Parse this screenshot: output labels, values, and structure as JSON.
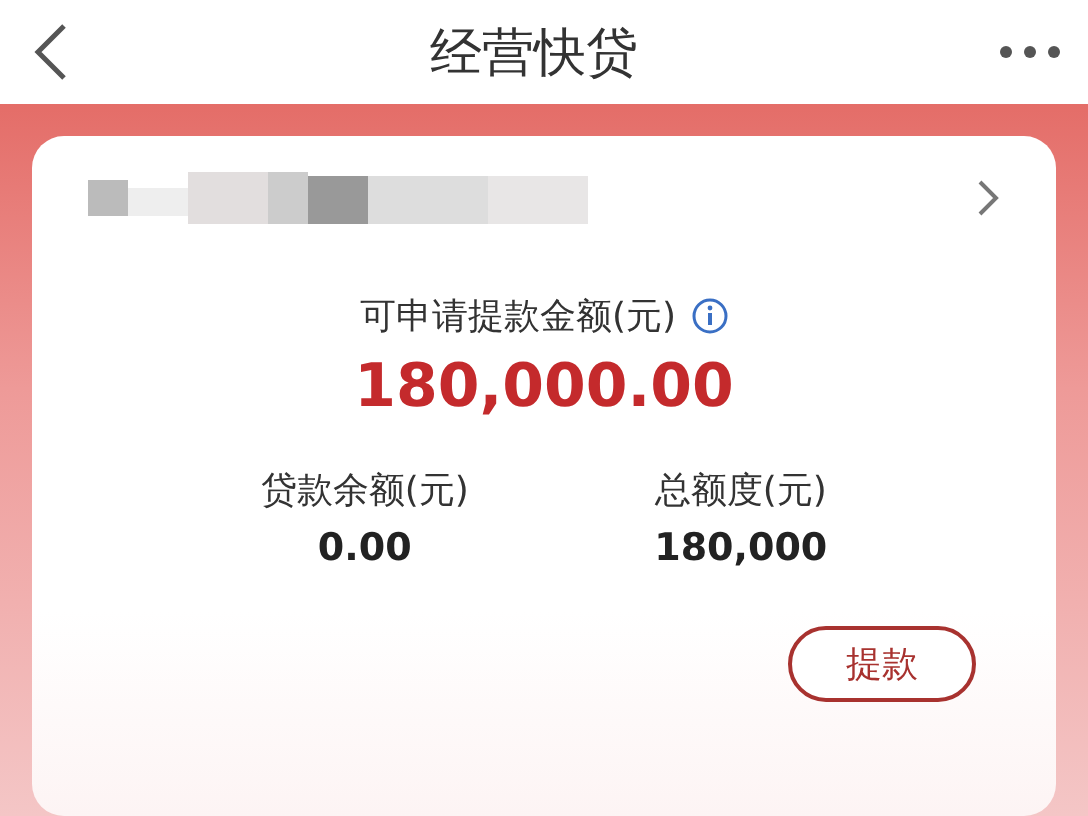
{
  "header": {
    "title": "经营快贷"
  },
  "card": {
    "available_label": "可申请提款金额(元)",
    "available_amount": "180,000.00",
    "stats": [
      {
        "label": "贷款余额(元)",
        "value": "0.00"
      },
      {
        "label": "总额度(元)",
        "value": "180,000"
      }
    ],
    "button": "提款"
  }
}
